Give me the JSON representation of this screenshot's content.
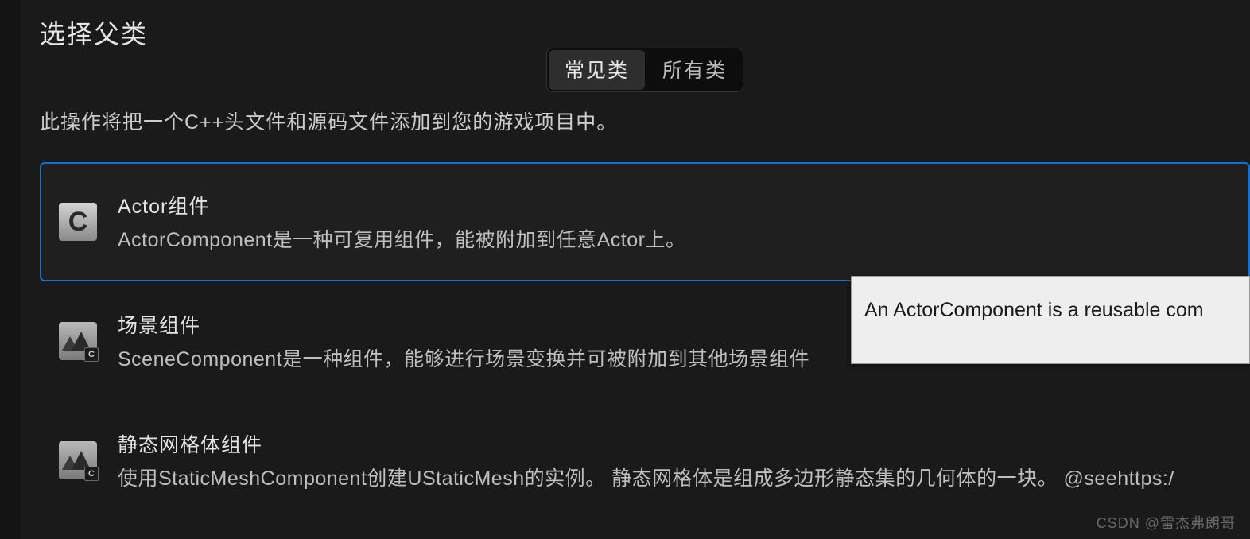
{
  "header": {
    "title": "选择父类"
  },
  "tabs": {
    "common": "常见类",
    "all": "所有类"
  },
  "description": "此操作将把一个C++头文件和源码文件添加到您的游戏项目中。",
  "classes": [
    {
      "icon": "c-class-icon",
      "name": "Actor组件",
      "desc": "ActorComponent是一种可复用组件，能被附加到任意Actor上。",
      "selected": true
    },
    {
      "icon": "scene-class-icon",
      "name": "场景组件",
      "desc": "SceneComponent是一种组件，能够进行场景变换并可被附加到其他场景组件",
      "selected": false
    },
    {
      "icon": "scene-class-icon",
      "name": "静态网格体组件",
      "desc": "使用StaticMeshComponent创建UStaticMesh的实例。 静态网格体是组成多边形静态集的几何体的一块。 @seehttps:/",
      "selected": false
    }
  ],
  "tooltip": "An ActorComponent is a reusable com",
  "watermark": "CSDN @雷杰弗朗哥"
}
